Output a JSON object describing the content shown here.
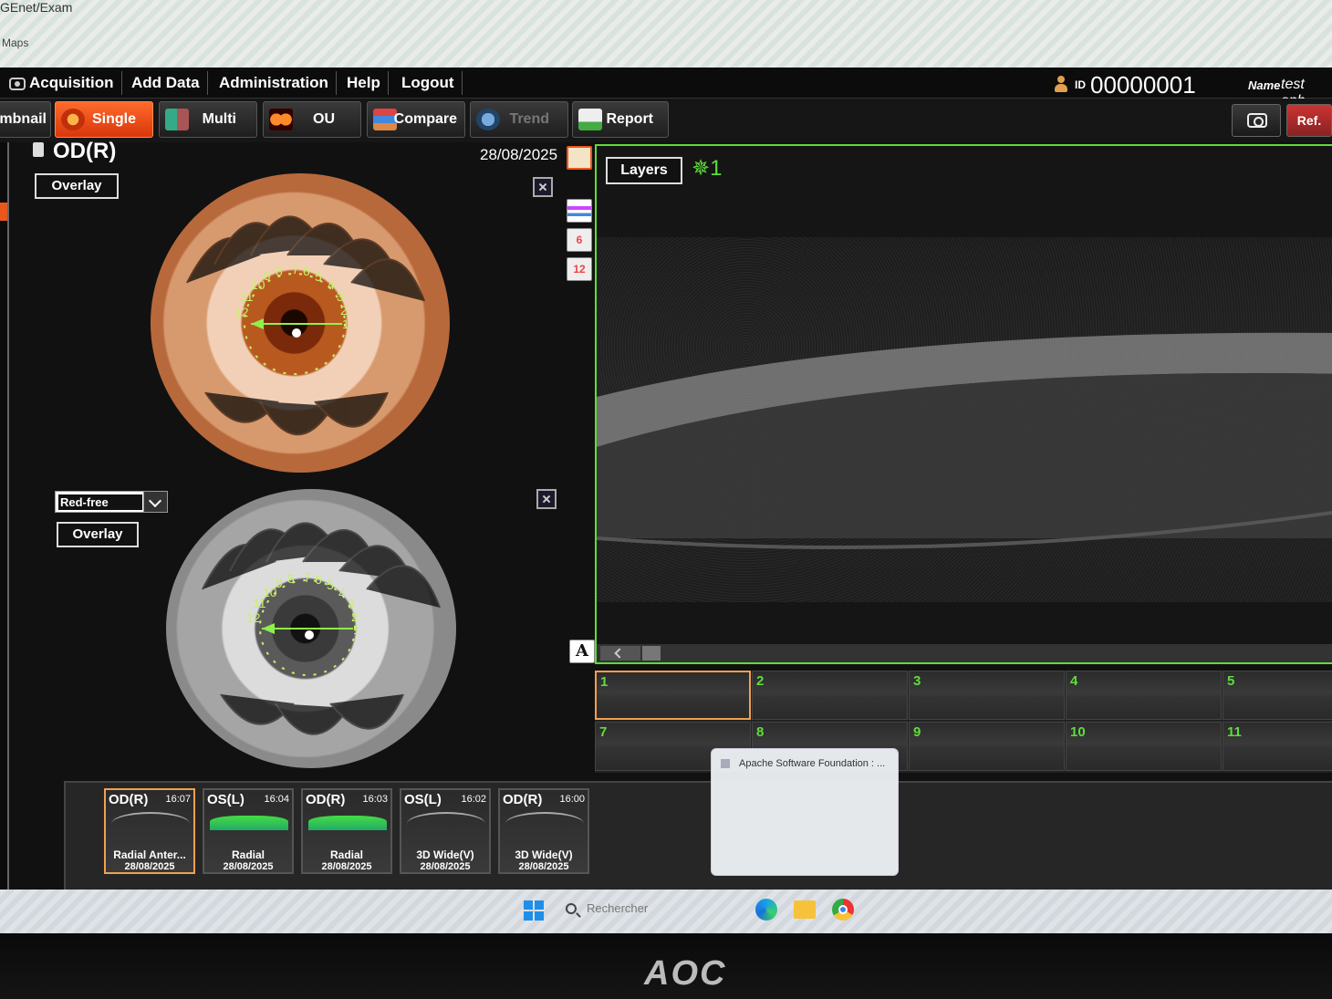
{
  "browser": {
    "url": "GEnet/Exam",
    "bookmark": "Maps"
  },
  "menu": {
    "items": [
      {
        "label": "Acquisition",
        "icon": "camera-icon"
      },
      {
        "label": "Add Data"
      },
      {
        "label": "Administration"
      },
      {
        "label": "Help"
      },
      {
        "label": "Logout"
      }
    ]
  },
  "patient": {
    "id_label": "ID",
    "id": "00000001",
    "name_label": "Name",
    "name": "test oph"
  },
  "toolbar": {
    "buttons": [
      {
        "label": "umbnail",
        "state": "normal"
      },
      {
        "label": "Single",
        "state": "active"
      },
      {
        "label": "Multi",
        "state": "normal"
      },
      {
        "label": "OU",
        "state": "normal"
      },
      {
        "label": "Compare",
        "state": "normal"
      },
      {
        "label": "Trend",
        "state": "disabled"
      },
      {
        "label": "Report",
        "state": "normal"
      }
    ],
    "ref_label": "Ref."
  },
  "left": {
    "eye": "OD(R)",
    "date": "28/08/2025",
    "overlay_label": "Overlay",
    "filter_value": "Red-free",
    "overlay2_label": "Overlay",
    "clock_numbers": [
      "12",
      "11",
      "10",
      "9",
      "8",
      "7",
      "6",
      "5",
      "4",
      "3",
      "2",
      "1"
    ]
  },
  "side_tools": {
    "six": "6",
    "twelve": "12",
    "text": "A"
  },
  "oct": {
    "layers_label": "Layers",
    "annotation": "✵1"
  },
  "scans": [
    "1",
    "2",
    "3",
    "4",
    "5",
    "7",
    "8",
    "9",
    "10",
    "11"
  ],
  "popup": {
    "title": "Apache Software Foundation : ..."
  },
  "exams": [
    {
      "eye": "OD(R)",
      "time": "16:07",
      "type": "Radial Anter...",
      "date": "28/08/2025",
      "selected": true
    },
    {
      "eye": "OS(L)",
      "time": "16:04",
      "type": "Radial",
      "date": "28/08/2025"
    },
    {
      "eye": "OD(R)",
      "time": "16:03",
      "type": "Radial",
      "date": "28/08/2025"
    },
    {
      "eye": "OS(L)",
      "time": "16:02",
      "type": "3D Wide(V)",
      "date": "28/08/2025"
    },
    {
      "eye": "OD(R)",
      "time": "16:00",
      "type": "3D Wide(V)",
      "date": "28/08/2025"
    }
  ],
  "taskbar": {
    "search_placeholder": "Rechercher"
  },
  "monitor": {
    "brand": "AOC"
  },
  "colors": {
    "accent": "#e8581c",
    "frame": "#5fdc3a",
    "annotation": "#5fdc3a"
  }
}
